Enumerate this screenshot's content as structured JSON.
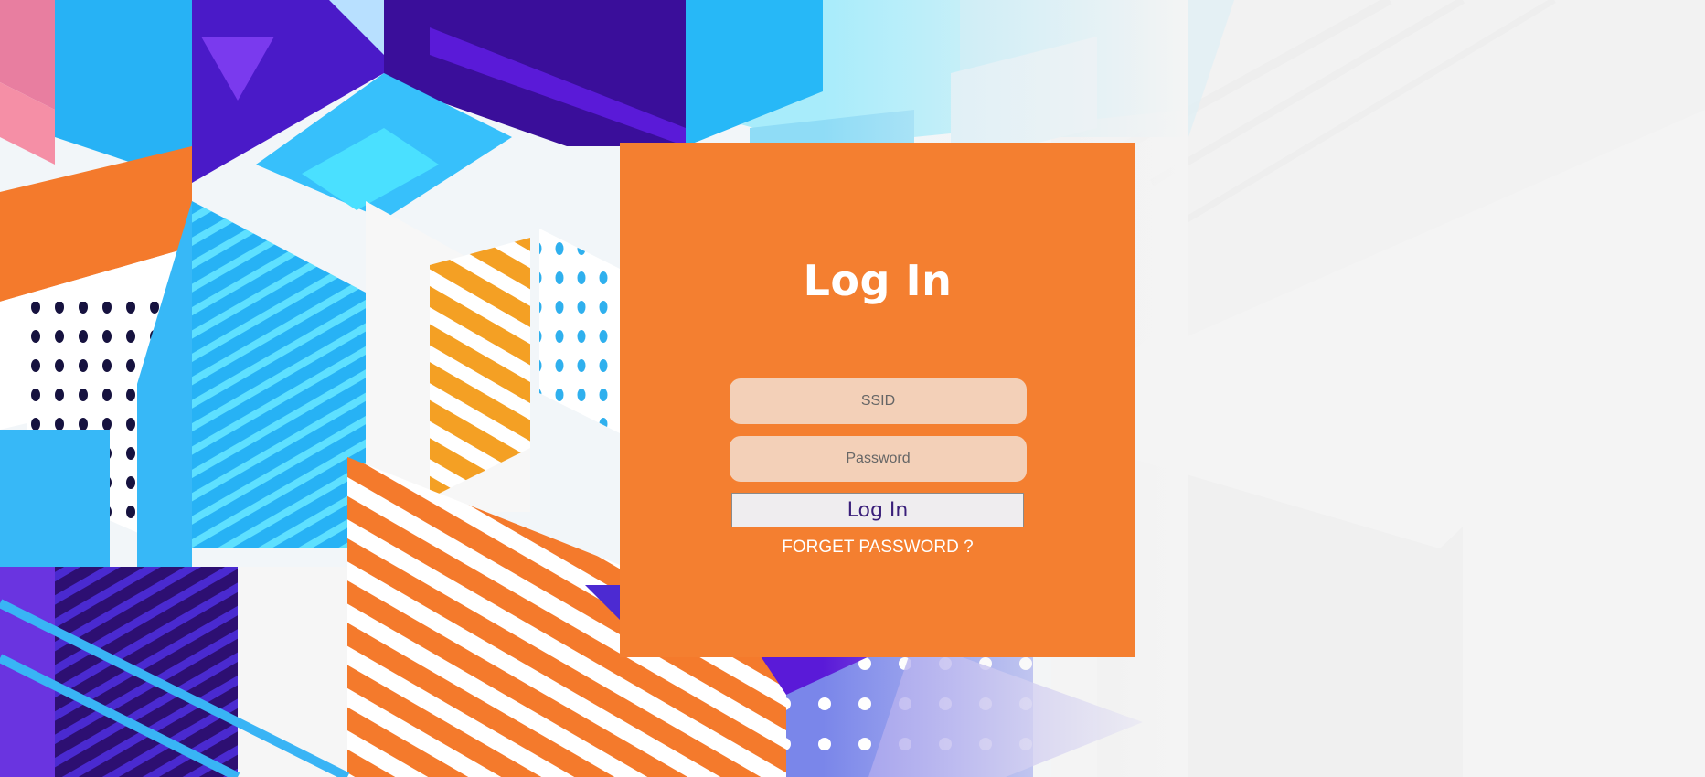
{
  "login": {
    "title": "Log In",
    "ssid_placeholder": "SSID",
    "password_placeholder": "Password",
    "submit_label": "Log In",
    "forgot_label": "FORGET PASSWORD ?"
  },
  "colors": {
    "card": "#f47f30",
    "field": "#f3d0b8",
    "button_text": "#3a1f7a",
    "background": "#f4f4f4"
  }
}
